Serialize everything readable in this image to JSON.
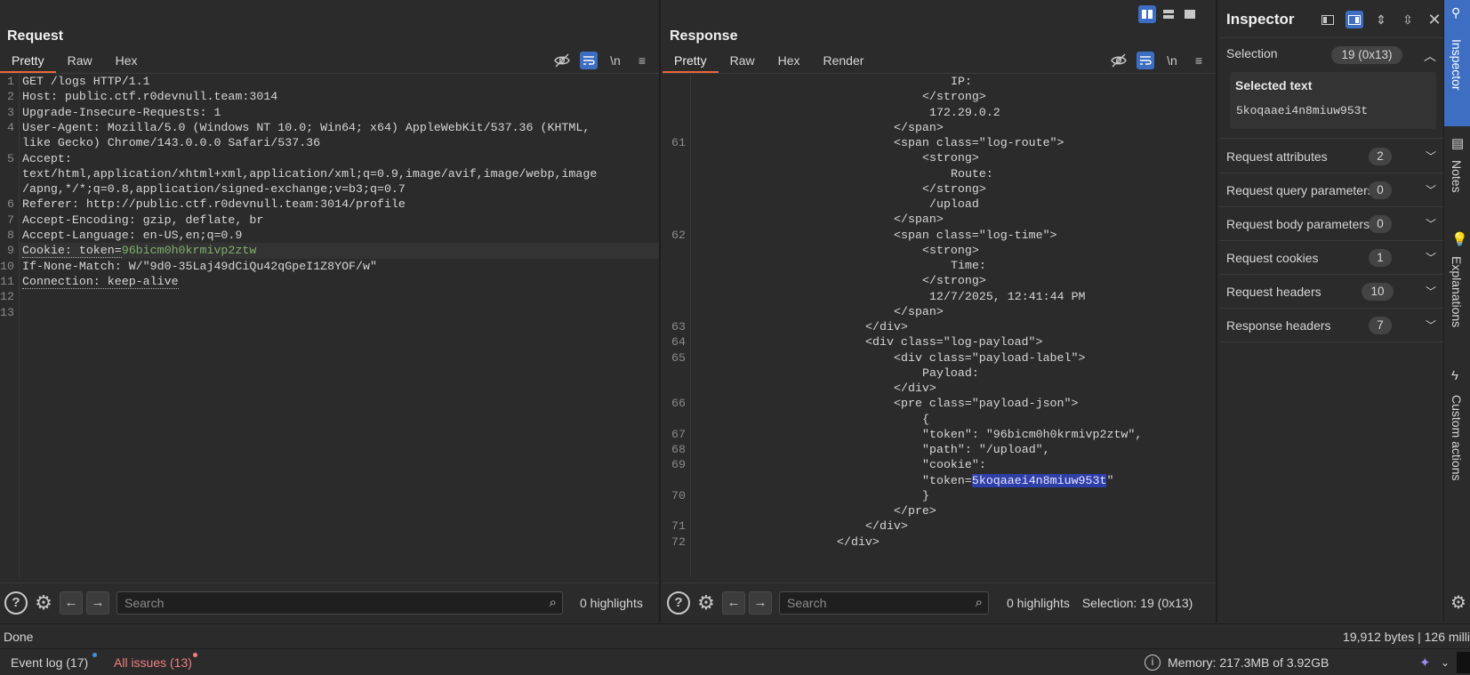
{
  "request": {
    "title": "Request",
    "tabs": [
      "Pretty",
      "Raw",
      "Hex"
    ],
    "active_tab": "Pretty",
    "lines": [
      {
        "n": "1",
        "text": "GET /logs HTTP/1.1"
      },
      {
        "n": "2",
        "text": "Host: public.ctf.r0devnull.team:3014"
      },
      {
        "n": "3",
        "text": "Upgrade-Insecure-Requests: 1"
      },
      {
        "n": "4",
        "text": "User-Agent: Mozilla/5.0 (Windows NT 10.0; Win64; x64) AppleWebKit/537.36 (KHTML,"
      },
      {
        "n": "",
        "text": "like Gecko) Chrome/143.0.0.0 Safari/537.36"
      },
      {
        "n": "5",
        "text": "Accept:"
      },
      {
        "n": "",
        "text": "text/html,application/xhtml+xml,application/xml;q=0.9,image/avif,image/webp,image"
      },
      {
        "n": "",
        "text": "/apng,*/*;q=0.8,application/signed-exchange;v=b3;q=0.7"
      },
      {
        "n": "6",
        "text": "Referer: http://public.ctf.r0devnull.team:3014/profile"
      },
      {
        "n": "7",
        "text": "Accept-Encoding: gzip, deflate, br"
      },
      {
        "n": "8",
        "text": "Accept-Language: en-US,en;q=0.9"
      },
      {
        "n": "9",
        "text": "Cookie: token=",
        "token": "96bicm0h0krmivp2ztw"
      },
      {
        "n": "10",
        "text": "If-None-Match: W/\"9d0-35Laj49dCiQu42qGpeI1Z8YOF/w\""
      },
      {
        "n": "11",
        "text": "Connection: keep-alive"
      },
      {
        "n": "12",
        "text": ""
      },
      {
        "n": "13",
        "text": ""
      }
    ],
    "search_placeholder": "Search",
    "highlights": "0 highlights"
  },
  "response": {
    "title": "Response",
    "tabs": [
      "Pretty",
      "Raw",
      "Hex",
      "Render"
    ],
    "active_tab": "Pretty",
    "lines": [
      {
        "n": "",
        "indent": 38,
        "text": "IP:"
      },
      {
        "n": "",
        "indent": 34,
        "text": "</strong>"
      },
      {
        "n": "",
        "indent": 34,
        "text": " 172.29.0.2"
      },
      {
        "n": "",
        "indent": 30,
        "text": "</span>"
      },
      {
        "n": "61",
        "indent": 30,
        "text": "<span class=\"log-route\">"
      },
      {
        "n": "",
        "indent": 34,
        "text": "<strong>"
      },
      {
        "n": "",
        "indent": 38,
        "text": "Route:"
      },
      {
        "n": "",
        "indent": 34,
        "text": "</strong>"
      },
      {
        "n": "",
        "indent": 34,
        "text": " /upload"
      },
      {
        "n": "",
        "indent": 30,
        "text": "</span>"
      },
      {
        "n": "62",
        "indent": 30,
        "text": "<span class=\"log-time\">"
      },
      {
        "n": "",
        "indent": 34,
        "text": "<strong>"
      },
      {
        "n": "",
        "indent": 38,
        "text": "Time:"
      },
      {
        "n": "",
        "indent": 34,
        "text": "</strong>"
      },
      {
        "n": "",
        "indent": 34,
        "text": " 12/7/2025, 12:41:44 PM"
      },
      {
        "n": "",
        "indent": 30,
        "text": "</span>"
      },
      {
        "n": "63",
        "indent": 26,
        "text": "</div>"
      },
      {
        "n": "64",
        "indent": 26,
        "text": "<div class=\"log-payload\">"
      },
      {
        "n": "65",
        "indent": 30,
        "text": "<div class=\"payload-label\">"
      },
      {
        "n": "",
        "indent": 34,
        "text": "Payload:"
      },
      {
        "n": "",
        "indent": 30,
        "text": "</div>"
      },
      {
        "n": "66",
        "indent": 30,
        "text": "<pre class=\"payload-json\">"
      },
      {
        "n": "",
        "indent": 34,
        "text": "{"
      },
      {
        "n": "67",
        "indent": 34,
        "text": "\"token\": \"96bicm0h0krmivp2ztw\","
      },
      {
        "n": "68",
        "indent": 34,
        "text": "\"path\": \"/upload\","
      },
      {
        "n": "69",
        "indent": 34,
        "text": "\"cookie\":"
      },
      {
        "n": "",
        "indent": 34,
        "text": "\"token=",
        "selected": "5koqaaei4n8miuw953t",
        "after": "\""
      },
      {
        "n": "70",
        "indent": 34,
        "text": "}"
      },
      {
        "n": "",
        "indent": 30,
        "text": "</pre>"
      },
      {
        "n": "71",
        "indent": 26,
        "text": "</div>"
      },
      {
        "n": "72",
        "indent": 22,
        "text": "</div>"
      }
    ],
    "search_placeholder": "Search",
    "highlights": "0 highlights",
    "selection": "Selection: 19 (0x13)"
  },
  "inspector": {
    "title": "Inspector",
    "selection_label": "Selection",
    "selection_badge": "19 (0x13)",
    "selected_text_label": "Selected text",
    "selected_text": "5koqaaei4n8miuw953t",
    "sections": [
      {
        "label": "Request attributes",
        "count": "2"
      },
      {
        "label": "Request query parameters",
        "count": "0"
      },
      {
        "label": "Request body parameters",
        "count": "0"
      },
      {
        "label": "Request cookies",
        "count": "1"
      },
      {
        "label": "Request headers",
        "count": "10"
      },
      {
        "label": "Response headers",
        "count": "7"
      }
    ]
  },
  "side_tabs": [
    "Inspector",
    "Notes",
    "Explanations",
    "Custom actions"
  ],
  "status": {
    "done": "Done",
    "bytes": "19,912 bytes | 126 milli",
    "event_log": "Event log (17)",
    "all_issues": "All issues (13)",
    "memory": "Memory: 217.3MB of 3.92GB"
  },
  "colors": {
    "accent": "#e8673c",
    "blue": "#3d6ec2",
    "issues": "#f08080"
  }
}
